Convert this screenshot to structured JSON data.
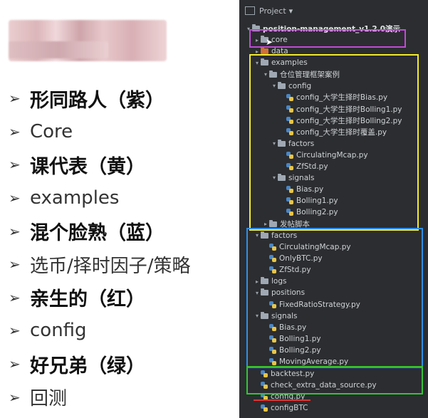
{
  "slide": {
    "bullets": [
      {
        "text": "形同路人（紫）",
        "bold": true
      },
      {
        "text": "Core",
        "bold": false
      },
      {
        "text": "课代表（黄）",
        "bold": true
      },
      {
        "text": "examples",
        "bold": false
      },
      {
        "text": "混个脸熟（蓝）",
        "bold": true
      },
      {
        "text": "选币/择时因子/策略",
        "bold": false
      },
      {
        "text": "亲生的（红）",
        "bold": true
      },
      {
        "text": "config",
        "bold": false
      },
      {
        "text": "好兄弟（绿）",
        "bold": true
      },
      {
        "text": "回测",
        "bold": false
      }
    ],
    "arrow_glyph": "➢"
  },
  "ide": {
    "header": {
      "title": "Project",
      "dropdown_glyph": "▾"
    },
    "tree": [
      {
        "label": "position-management_v1.2.0演示",
        "depth": 0,
        "kind": "folder",
        "expanded": true
      },
      {
        "label": "core",
        "depth": 1,
        "kind": "folder",
        "expanded": false
      },
      {
        "label": "data",
        "depth": 1,
        "kind": "folder-data",
        "expanded": false
      },
      {
        "label": "examples",
        "depth": 1,
        "kind": "folder",
        "expanded": true
      },
      {
        "label": "仓位管理框架案例",
        "depth": 2,
        "kind": "folder",
        "expanded": true
      },
      {
        "label": "config",
        "depth": 3,
        "kind": "folder",
        "expanded": true
      },
      {
        "label": "config_大学生择时Bias.py",
        "depth": 4,
        "kind": "py"
      },
      {
        "label": "config_大学生择时Bolling1.py",
        "depth": 4,
        "kind": "py"
      },
      {
        "label": "config_大学生择时Bolling2.py",
        "depth": 4,
        "kind": "py"
      },
      {
        "label": "config_大学生择时覆盖.py",
        "depth": 4,
        "kind": "py"
      },
      {
        "label": "factors",
        "depth": 3,
        "kind": "folder",
        "expanded": true
      },
      {
        "label": "CirculatingMcap.py",
        "depth": 4,
        "kind": "py"
      },
      {
        "label": "ZfStd.py",
        "depth": 4,
        "kind": "py"
      },
      {
        "label": "signals",
        "depth": 3,
        "kind": "folder",
        "expanded": true
      },
      {
        "label": "Bias.py",
        "depth": 4,
        "kind": "py"
      },
      {
        "label": "Bolling1.py",
        "depth": 4,
        "kind": "py"
      },
      {
        "label": "Bolling2.py",
        "depth": 4,
        "kind": "py"
      },
      {
        "label": "发帖脚本",
        "depth": 2,
        "kind": "folder",
        "expanded": false
      },
      {
        "label": "factors",
        "depth": 1,
        "kind": "folder",
        "expanded": true
      },
      {
        "label": "CirculatingMcap.py",
        "depth": 2,
        "kind": "py"
      },
      {
        "label": "OnlyBTC.py",
        "depth": 2,
        "kind": "py"
      },
      {
        "label": "ZfStd.py",
        "depth": 2,
        "kind": "py"
      },
      {
        "label": "logs",
        "depth": 1,
        "kind": "folder",
        "expanded": false
      },
      {
        "label": "positions",
        "depth": 1,
        "kind": "folder",
        "expanded": true
      },
      {
        "label": "FixedRatioStrategy.py",
        "depth": 2,
        "kind": "py"
      },
      {
        "label": "signals",
        "depth": 1,
        "kind": "folder",
        "expanded": true
      },
      {
        "label": "Bias.py",
        "depth": 2,
        "kind": "py"
      },
      {
        "label": "Bolling1.py",
        "depth": 2,
        "kind": "py"
      },
      {
        "label": "Bolling2.py",
        "depth": 2,
        "kind": "py"
      },
      {
        "label": "MovingAverage.py",
        "depth": 2,
        "kind": "py"
      },
      {
        "label": "backtest.py",
        "depth": 1,
        "kind": "py"
      },
      {
        "label": "check_extra_data_source.py",
        "depth": 1,
        "kind": "py"
      },
      {
        "label": "config.py",
        "depth": 1,
        "kind": "py"
      },
      {
        "label": "configBTC",
        "depth": 1,
        "kind": "py"
      }
    ]
  },
  "colors": {
    "magenta": "#c04bd6",
    "yellow": "#f2ea2e",
    "blue": "#2f8fe6",
    "green": "#37c23a",
    "red": "#e03232",
    "ide_bg": "#2b2d30"
  }
}
